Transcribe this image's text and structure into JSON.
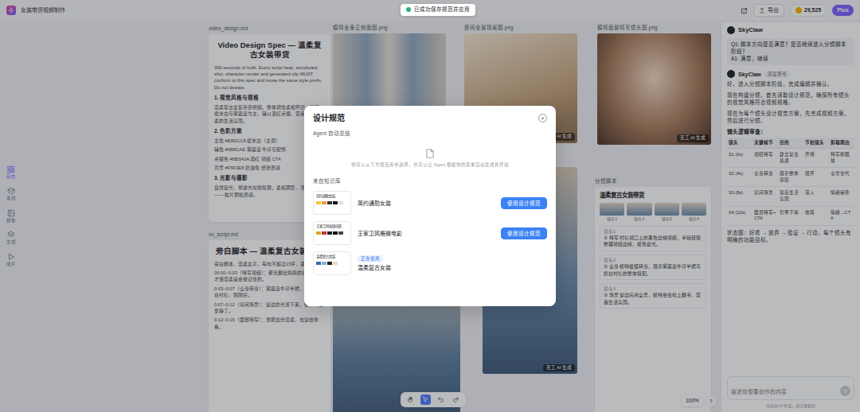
{
  "window": {
    "title": "女装带货视频制作"
  },
  "toast": {
    "text": "已成功保存规范并应用"
  },
  "topbar": {
    "export": "导出",
    "credits": "29,525",
    "plan": "Plus"
  },
  "sidebar": {
    "items": [
      {
        "label": "画布",
        "selected": true
      },
      {
        "label": "素材",
        "selected": false
      },
      {
        "label": "模板",
        "selected": false
      },
      {
        "label": "生成",
        "selected": false
      },
      {
        "label": "成片",
        "selected": false
      }
    ]
  },
  "canvas": {
    "docs": [
      {
        "file": "video_design.md",
        "title": "Video Design Spec — 温柔复古女装带货",
        "lines": [
          {
            "kind": "p",
            "text": "300 seconds of truth. Every script beat, storyboard shot, character render and generated clip MUST conform to this spec and reuse the same style prefix. Do not deviate."
          },
          {
            "kind": "h",
            "text": "1. 视觉风格与规格"
          },
          {
            "kind": "p",
            "text": "温柔复古女装带货视频。整体调性柔和怀旧，画面以暖米白与雾霾蓝为主，辅以酒红点缀，营造安静、温柔的生活氛围。"
          },
          {
            "kind": "h",
            "text": "2. 色彩方案"
          },
          {
            "kind": "p",
            "text": "主色  #E8DCC8  暖米白（主调）"
          },
          {
            "kind": "p",
            "text": "辅色  #6B8CAE  雾霾蓝 牛仔与配饰"
          },
          {
            "kind": "p",
            "text": "点缀色  #8B3A3A  酒红 领结 CTA"
          },
          {
            "kind": "p",
            "text": "背景  #F5F0E8  奶油色 纸张质感"
          },
          {
            "kind": "h",
            "text": "3. 光影与摄影"
          },
          {
            "kind": "p",
            "text": "自然窗光，侧逆光勾勒轮廓，柔和阴影，浅景深 —— 胶片颗粒质感。"
          }
        ]
      },
      {
        "file": "vo_script.md",
        "title": "旁白脚本 — 温柔复古女装带货",
        "lines": [
          {
            "kind": "p",
            "text": "旁白脚本，温柔女声，每句不超过15字，语速舒缓。"
          },
          {
            "kind": "p",
            "text": "00:00–0:03（特写领结）：那天翻出妈妈的旧衬衫，才懂温柔是会被记住的。"
          },
          {
            "kind": "p",
            "text": "0:03–0:07（全身转身）：雾霾蓝牛仔半裙，配一件奶白衬衫，刚刚好。"
          },
          {
            "kind": "p",
            "text": "0:07–0:12（房间场景）：窗边的光落下来，整个人都安静了。"
          },
          {
            "kind": "p",
            "text": "0:12–0:15（面部特写）：想把这份温柔，也穿给你看。"
          }
        ]
      }
    ],
    "images": [
      {
        "file": "模特全身正侧面图.png"
      },
      {
        "file": "房间全景场景图.png",
        "badge": "天工 AI 生成"
      },
      {
        "file": "模特面部特写镜头图.png",
        "badge": "天工 AI 生成"
      },
      {},
      {
        "badge": "天工 AI 生成"
      }
    ],
    "storyboard": {
      "file": "分镜脚本",
      "title": "温柔复古女装带货",
      "thumbs": [
        "镜头1",
        "镜头2",
        "镜头3",
        "镜头4"
      ],
      "shots": [
        {
          "label": "镜头1",
          "text": "① 特写 衬衫领口上的黑色丝绒领结，手指轻轻整理领结边缘，暖色窗光。"
        },
        {
          "label": "镜头2",
          "text": "② 全身 模特缓慢转身，展示雾霾蓝牛仔半裙与奶白衬衫的整体搭配。"
        },
        {
          "label": "镜头3",
          "text": "③ 场景 窗边房间全景，模特坐在椅上翻书，营造生活氛围。"
        }
      ]
    }
  },
  "chat": {
    "name": "SkyClaw",
    "question": "Q1: 脚本方向是否满意？是否继续进入分镜脚本阶段？",
    "answer": "A1: 满意，继续",
    "bot": "SkyClaw",
    "chip": "深度思考",
    "paragraphs": [
      "好，进入分镜脚本阶段，完成编辑并确认。",
      "现在构建分镜。首先读取设计规范，确保所有镜头的视觉风格符合视频规格。",
      "现在为每个镜头设计视觉方案，先完成视频方案，然后进行分镜。"
    ],
    "table_title": "镜头逻辑审查：",
    "columns": [
      "镜头",
      "关键帧节",
      "目的",
      "节拍镜头",
      "剪辑理由"
    ],
    "rows": [
      [
        "S1 (0s)",
        "领结特写",
        "建立复古基调",
        "开场",
        "特写抓眼球"
      ],
      [
        "S2 (4s)",
        "全身转身",
        "展示整体穿搭",
        "展开",
        "全景交代"
      ],
      [
        "S3 (8s)",
        "房间场景",
        "营造生活氛围",
        "深入",
        "情绪铺垫"
      ],
      [
        "S4 (12s)",
        "面部特写+CTA",
        "引导下单",
        "收尾",
        "情绪→CTA"
      ]
    ],
    "summary": "状态图：好看 → 放弃 → 验证 → 行动。每个镜头有明确的功能目标。",
    "placeholder": "描述你想要创作的内容",
    "footnote": "内容由 AI 生成，请注意甄别"
  },
  "modal": {
    "title": "设计规范",
    "close": "×",
    "auto_label": "Agent 自动总结",
    "empty_text": "你可以从下方规范库中选择，也可以让 Agent 根据你的需求自动生成并开展",
    "library_label": "来自知识库",
    "items": [
      {
        "name": "简约通勤女装",
        "selected": false,
        "action": "使用设计规范",
        "swatches": [
          "#f2c94c",
          "#f2994a",
          "#333333",
          "#111111",
          "#e0e0e0"
        ]
      },
      {
        "name": "王家卫风格微电影",
        "selected": false,
        "action": "使用设计规范",
        "swatches": [
          "#d4a72c",
          "#c0392b",
          "#222222",
          "#111111",
          "#444444"
        ]
      },
      {
        "name": "温柔复古女装",
        "selected": true,
        "tag": "正在使用",
        "swatches": [
          "#3a6ea5",
          "#7fb3d5",
          "#222222",
          "#e8dcc8"
        ]
      }
    ]
  },
  "toolbar": {
    "tools": [
      {
        "kind": "hand",
        "selected": false
      },
      {
        "kind": "pointer",
        "selected": true
      },
      {
        "kind": "undo",
        "selected": false
      },
      {
        "kind": "redo",
        "selected": false
      }
    ],
    "zoom": "100%",
    "help": "?"
  }
}
